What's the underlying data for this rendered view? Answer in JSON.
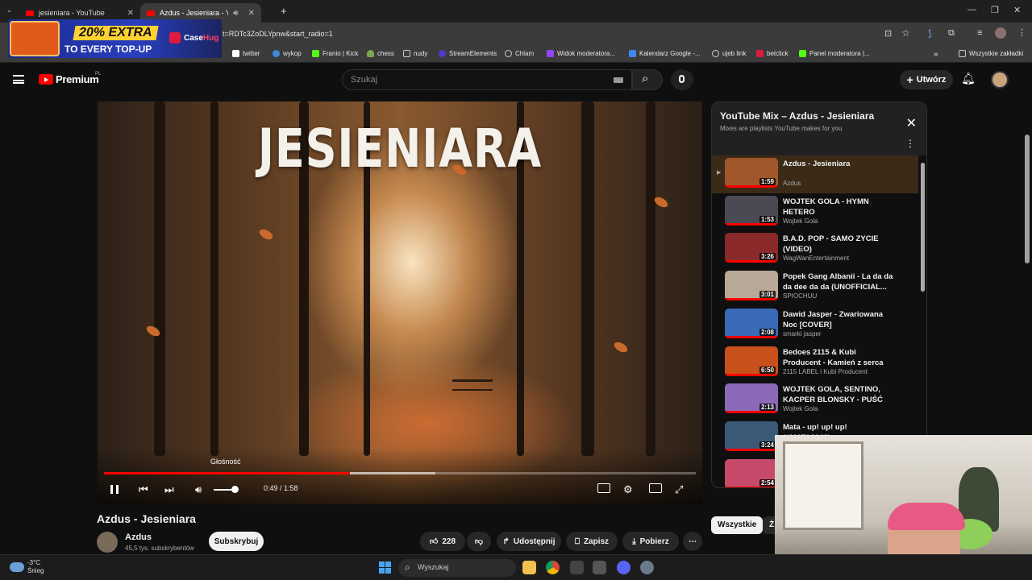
{
  "browser": {
    "tabs": [
      {
        "title": "jesieniara - YouTube",
        "active": false
      },
      {
        "title": "Azdus - Jesieniara - YouTub",
        "active": true
      }
    ],
    "url_visible": "t=RDTc3ZoDLYpnw&start_radio=1",
    "bookmarks": [
      {
        "label": "twitter",
        "color": "#ffffff"
      },
      {
        "label": "wykop",
        "color": "#3b8bd6"
      },
      {
        "label": "Franio | Kick",
        "color": "#53fc18"
      },
      {
        "label": "chess",
        "color": "#7fa650"
      },
      {
        "label": "nudy",
        "color": "#c9c9c9"
      },
      {
        "label": "StreamElements",
        "color": "#4d3bc8"
      },
      {
        "label": "Chlam",
        "color": "#cccccc"
      },
      {
        "label": "Widok moderatora...",
        "color": "#9146ff"
      },
      {
        "label": "Kalendarz Google -...",
        "color": "#4285f4"
      },
      {
        "label": "ujeb link",
        "color": "#dddddd"
      },
      {
        "label": "betclick",
        "color": "#e0193f"
      },
      {
        "label": "Panel moderatora |...",
        "color": "#53fc18"
      }
    ],
    "all_bookmarks": "Wszystkie zakładki"
  },
  "ad": {
    "line1": "20% EXTRA",
    "line2": "TO EVERY TOP-UP",
    "brand_a": "Case",
    "brand_b": "Hug"
  },
  "youtube": {
    "logo_text": "Premium",
    "region": "PL",
    "search_placeholder": "Szukaj",
    "create_label": "Utwórz"
  },
  "player": {
    "video_title_overlay": "JESIENIARA",
    "tooltip": "Głośność",
    "time_current": "0:49",
    "time_total": "1:58",
    "progress_fraction": 0.415,
    "buffer_fraction": 0.56,
    "volume_fraction": 0.85
  },
  "video": {
    "title": "Azdus - Jesieniara",
    "channel": "Azdus",
    "subscribers": "45,5 tys. subskrybentów",
    "subscribe_label": "Subskrybuj",
    "likes": "228",
    "share_label": "Udostępnij",
    "save_label": "Zapisz",
    "download_label": "Pobierz"
  },
  "playlist": {
    "title": "YouTube Mix – Azdus - Jesieniara",
    "subtitle": "Mixes are playlists YouTube makes for you",
    "items": [
      {
        "title": "Azdus - Jesieniara",
        "channel": "Azdus",
        "duration": "1:59",
        "color": "#a0582a",
        "current": true
      },
      {
        "title": "WOJTEK GOLA - HYMN HETERO",
        "channel": "Wojtek Gola",
        "duration": "1:53",
        "color": "#4a4a55",
        "current": false
      },
      {
        "title": "B.A.D. POP - SAMO ZYCIE (VIDEO)",
        "channel": "WagWanEntertainment",
        "duration": "3:26",
        "color": "#8a2a2a",
        "current": false
      },
      {
        "title": "Popek Gang Albanii - La da da da dee da da (UNOFFICIAL...",
        "channel": "SPIOCHUU",
        "duration": "3:01",
        "color": "#b8a898",
        "current": false
      },
      {
        "title": "Dawid Jasper - Zwariowana Noc [COVER]",
        "channel": "smarki jasper",
        "duration": "2:08",
        "color": "#3a6ab8",
        "current": false
      },
      {
        "title": "Bedoes 2115 & Kubi Producent - Kamień z serca",
        "channel": "2115 LABEL i Kubi Producent",
        "duration": "6:50",
        "color": "#c8501a",
        "current": false
      },
      {
        "title": "WOJTEK GOLA, SENTINO, KACPER BLONSKY - PUŚĆ TO...",
        "channel": "Wojtek Gola",
        "duration": "2:13",
        "color": "#8a6ab8",
        "current": false
      },
      {
        "title": "Mata - up! up! up! (#MATA2040)",
        "channel": "",
        "duration": "3:24",
        "color": "#3a5a78",
        "current": false
      },
      {
        "title": "",
        "channel": "",
        "duration": "2:54",
        "color": "#c84a6a",
        "current": false
      }
    ]
  },
  "chips": {
    "active": "Wszystkie",
    "other": "Ż"
  },
  "taskbar": {
    "temperature": "-3°C",
    "condition": "Śnieg",
    "search_label": "Wyszukaj"
  }
}
